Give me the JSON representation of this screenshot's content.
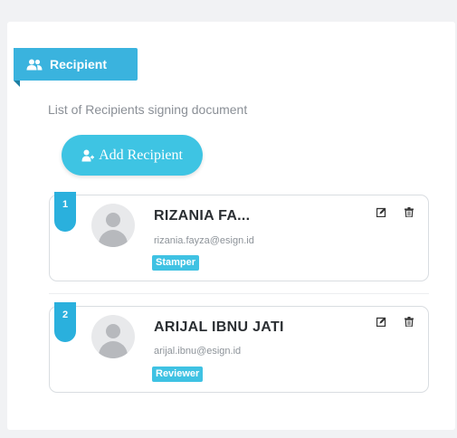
{
  "section": {
    "title": "Recipient",
    "subtitle": "List of Recipients signing document",
    "title_icon": "users-icon"
  },
  "add_button": {
    "label": "Add Recipient",
    "icon": "user-plus-icon"
  },
  "recipients": [
    {
      "order": "1",
      "name": "RIZANIA FA...",
      "email": "rizania.fayza@esign.id",
      "role": "Stamper",
      "actions": [
        "edit-icon",
        "trash-icon"
      ]
    },
    {
      "order": "2",
      "name": "ARIJAL IBNU JATI",
      "email": "arijal.ibnu@esign.id",
      "role": "Reviewer",
      "actions": [
        "edit-icon",
        "trash-icon"
      ]
    }
  ],
  "colors": {
    "accent": "#3ab3de",
    "button": "#3ec4e3",
    "badge": "#2ab0dd",
    "role_badge": "#3fc2e3"
  }
}
